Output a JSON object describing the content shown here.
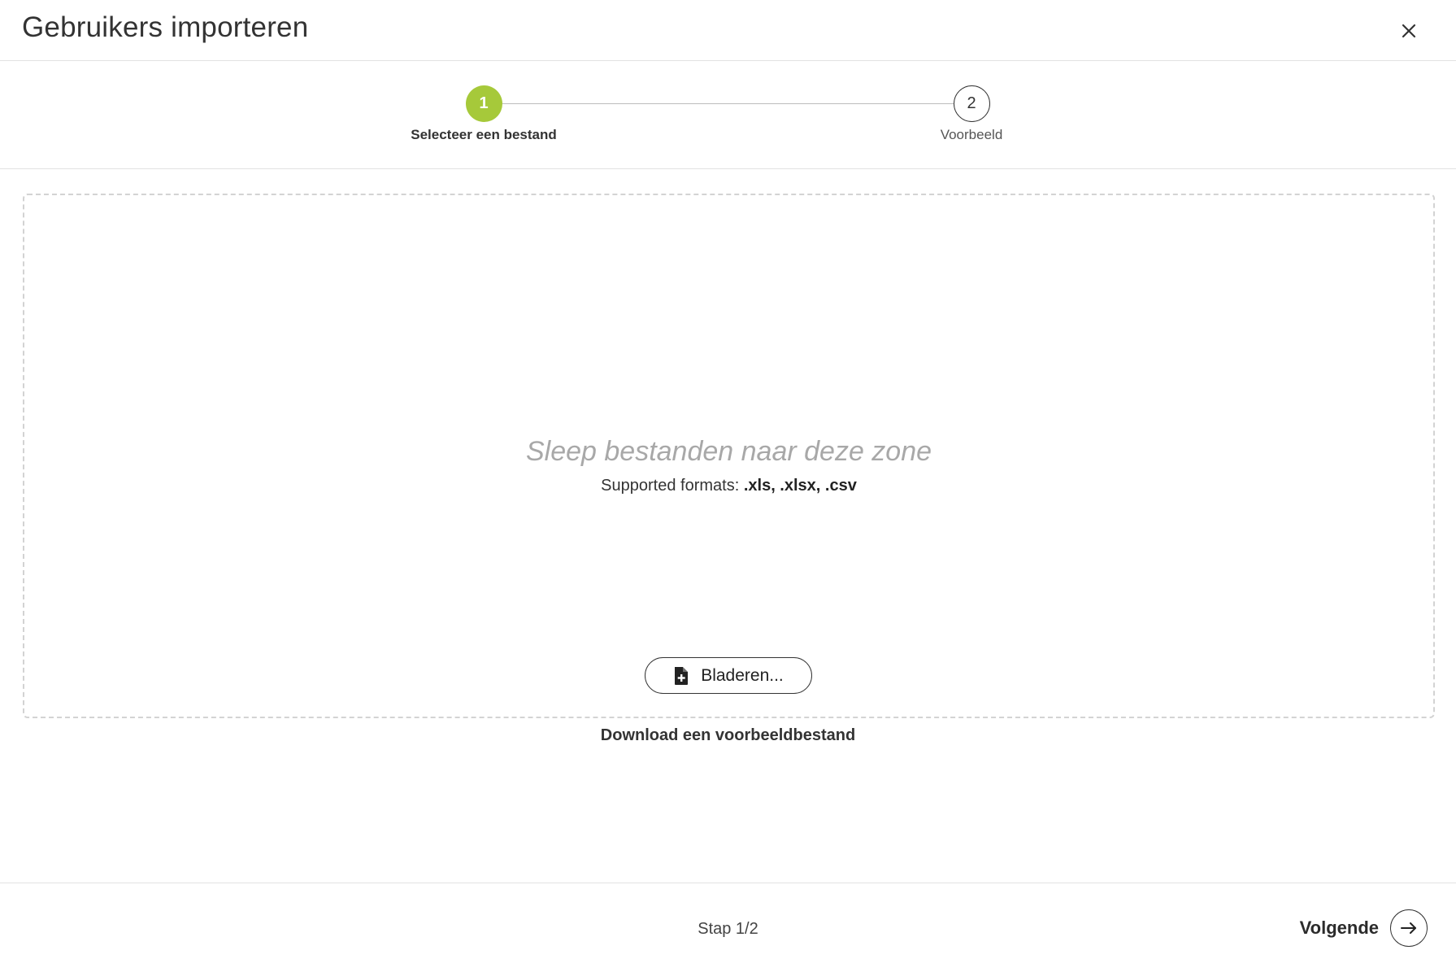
{
  "header": {
    "title": "Gebruikers importeren",
    "close_icon": "close-icon"
  },
  "stepper": {
    "steps": [
      {
        "number": "1",
        "label": "Selecteer een bestand",
        "state": "active"
      },
      {
        "number": "2",
        "label": "Voorbeeld",
        "state": "inactive"
      }
    ],
    "active_color": "#a6c93a"
  },
  "dropzone": {
    "drop_text": "Sleep bestanden naar deze zone",
    "formats_label": "Supported formats: ",
    "formats_value": ".xls, .xlsx, .csv",
    "browse_label": "Bladeren...",
    "browse_icon": "file-add-icon"
  },
  "download_link": "Download een voorbeeldbestand",
  "footer": {
    "step_counter": "Stap 1/2",
    "next_label": "Volgende",
    "next_icon": "arrow-right-icon"
  }
}
